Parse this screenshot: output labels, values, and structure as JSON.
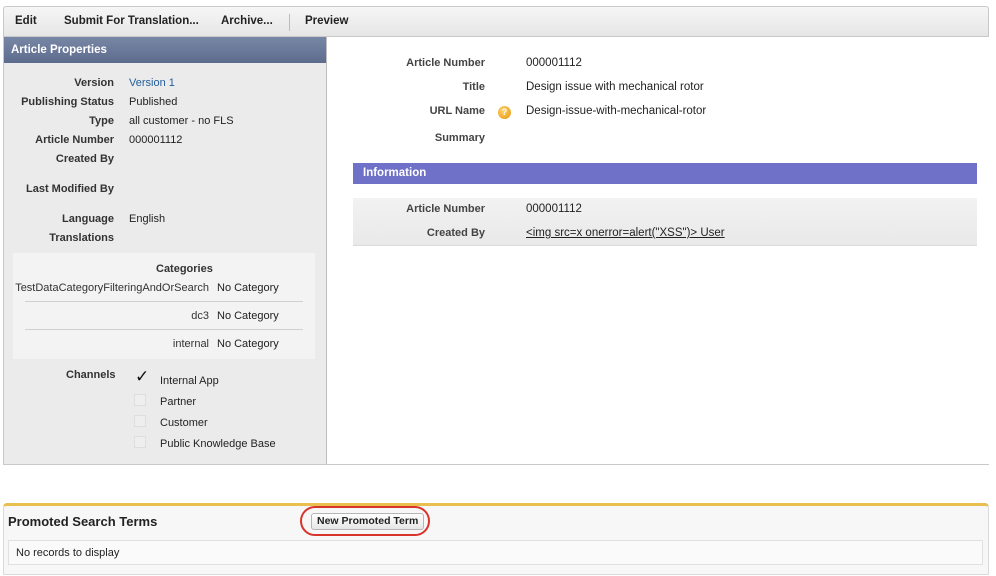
{
  "toolbar": {
    "edit": "Edit",
    "submit_translation": "Submit For Translation...",
    "archive": "Archive...",
    "preview": "Preview"
  },
  "left_panel": {
    "title": "Article Properties",
    "properties": [
      {
        "label": "Version",
        "value": "Version 1",
        "is_link": true
      },
      {
        "label": "Publishing Status",
        "value": "Published"
      },
      {
        "label": "Type",
        "value": "all customer - no FLS"
      },
      {
        "label": "Article Number",
        "value": "000001112"
      },
      {
        "label": "Created By",
        "value": ""
      },
      {
        "label": "Last Modified By",
        "value": ""
      },
      {
        "label": "Language",
        "value": "English"
      },
      {
        "label": "Translations",
        "value": ""
      }
    ],
    "categories": {
      "title": "Categories",
      "rows": [
        {
          "name": "TestDataCategoryFilteringAndOrSearch",
          "value": "No Category"
        },
        {
          "name": "dc3",
          "value": "No Category"
        },
        {
          "name": "internal",
          "value": "No Category"
        }
      ]
    },
    "channels": {
      "label": "Channels",
      "items": [
        {
          "name": "Internal App",
          "checked": true
        },
        {
          "name": "Partner",
          "checked": false
        },
        {
          "name": "Customer",
          "checked": false
        },
        {
          "name": "Public Knowledge Base",
          "checked": false
        }
      ]
    }
  },
  "detail": {
    "article_number_label": "Article Number",
    "article_number": "000001112",
    "title_label": "Title",
    "title": "Design issue with mechanical rotor",
    "url_name_label": "URL Name",
    "url_name": "Design-issue-with-mechanical-rotor",
    "help_icon": "help-icon",
    "summary_label": "Summary",
    "summary": ""
  },
  "information": {
    "title": "Information",
    "article_number_label": "Article Number",
    "article_number": "000001112",
    "created_by_label": "Created By",
    "created_by": "<img src=x onerror=alert(\"XSS\")> User"
  },
  "promoted_terms": {
    "title": "Promoted Search Terms",
    "new_button": "New Promoted Term",
    "empty_text": "No records to display"
  },
  "colors": {
    "left_header": "#6a7899",
    "information_header": "#6f70c8",
    "promo_accent": "#e9c04f",
    "highlight_ring": "#d9342b"
  }
}
